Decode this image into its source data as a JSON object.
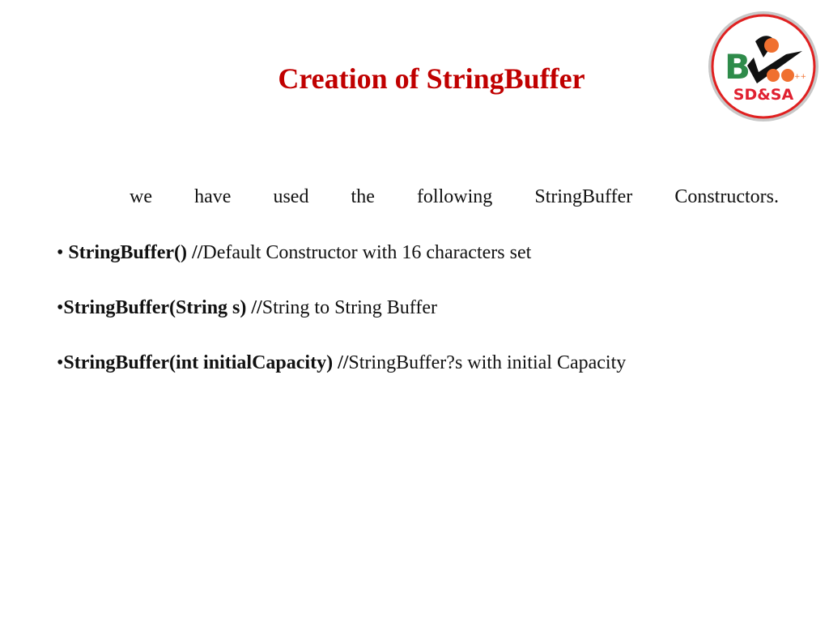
{
  "slide": {
    "title": "Creation of StringBuffer",
    "title_color": "#c00000",
    "logo": {
      "text": "SD&SA",
      "brand_letters": "BVoc",
      "border_color": "#e02020",
      "icon": "bvoc-sdsa-logo-icon"
    },
    "intro_words": [
      "we",
      "have",
      "used",
      "the",
      "following",
      "StringBuffer",
      "Constructors."
    ],
    "bullets": [
      {
        "marker": "• ",
        "code": "StringBuffer()",
        "comment_prefix": " //",
        "comment": "Default Constructor with 16 characters set"
      },
      {
        "marker": "•",
        "code": "StringBuffer(String s)",
        "comment_prefix": " //",
        "comment": "String to String Buffer"
      },
      {
        "marker": "•",
        "code": "StringBuffer(int initialCapacity)",
        "comment_prefix": " //",
        "comment": "StringBuffer?s with initial Capacity"
      }
    ]
  }
}
